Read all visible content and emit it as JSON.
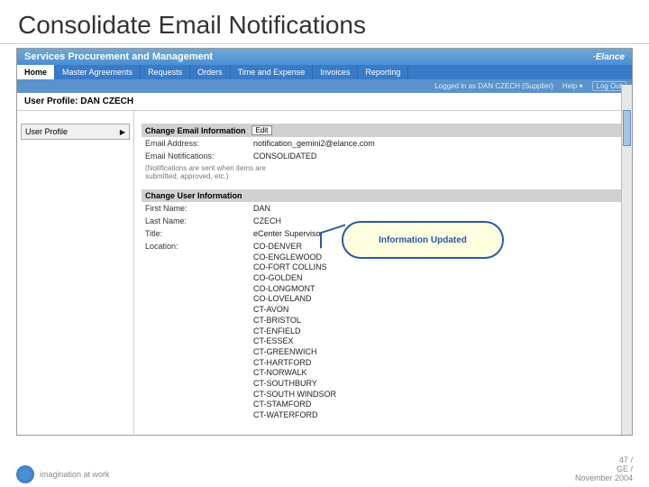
{
  "slide": {
    "title": "Consolidate Email Notifications"
  },
  "header": {
    "title": "Services Procurement and Management",
    "brand": "·Elance"
  },
  "tabs": [
    {
      "label": "Home",
      "active": true
    },
    {
      "label": "Master Agreements"
    },
    {
      "label": "Requests"
    },
    {
      "label": "Orders"
    },
    {
      "label": "Time and Expense"
    },
    {
      "label": "Invoices"
    },
    {
      "label": "Reporting"
    }
  ],
  "status": {
    "logged_in": "Logged in as DAN CZECH (Supplier)",
    "help": "Help ▾",
    "logout": "Log Out"
  },
  "profile": {
    "title": "User Profile:  DAN CZECH"
  },
  "sidebar": {
    "item_label": "User Profile"
  },
  "email_section": {
    "title": "Change Email Information",
    "edit": "Edit",
    "email_label": "Email Address:",
    "email_value": "notification_gemini2@elance.com",
    "notif_label": "Email Notifications:",
    "notif_value": "CONSOLIDATED",
    "note": "(Notifications are sent when items are submitted, approved, etc.)"
  },
  "user_section": {
    "title": "Change User Information",
    "first_label": "First Name:",
    "first_value": "DAN",
    "last_label": "Last Name:",
    "last_value": "CZECH",
    "title_label": "Title:",
    "title_value": "eCenter Supervisor",
    "loc_label": "Location:",
    "locations": [
      "CO-DENVER",
      "CO-ENGLEWOOD",
      "CO-FORT COLLINS",
      "CO-GOLDEN",
      "CO-LONGMONT",
      "CO-LOVELAND",
      "CT-AVON",
      "CT-BRISTOL",
      "CT-ENFIELD",
      "CT-ESSEX",
      "CT-GREENWICH",
      "CT-HARTFORD",
      "CT-NORWALK",
      "CT-SOUTHBURY",
      "CT-SOUTH WINDSOR",
      "CT-STAMFORD",
      "CT-WATERFORD"
    ]
  },
  "callout": {
    "text": "Information Updated"
  },
  "footer": {
    "tagline": "imagination at work",
    "page": "47 /",
    "company": "GE /",
    "date": "November 2004"
  }
}
